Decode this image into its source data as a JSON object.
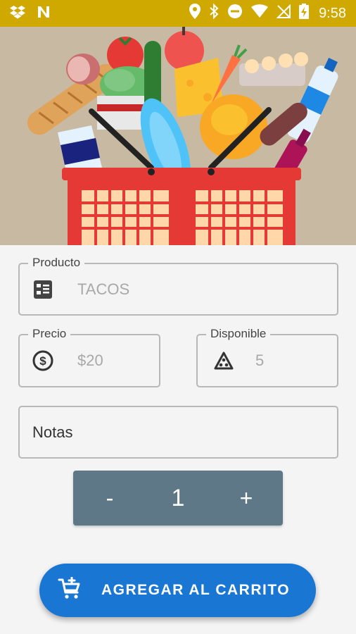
{
  "status_bar": {
    "time": "9:58",
    "icons": [
      "dropbox-icon",
      "n-app-icon",
      "location-icon",
      "bluetooth-icon",
      "do-not-disturb-icon",
      "wifi-icon",
      "no-signal-icon",
      "battery-charging-icon"
    ]
  },
  "form": {
    "producto": {
      "label": "Producto",
      "value": "TACOS",
      "icon": "list-icon"
    },
    "precio": {
      "label": "Precio",
      "value": "$20",
      "icon": "dollar-circle-icon"
    },
    "disponible": {
      "label": "Disponible",
      "value": "5",
      "icon": "stock-triangle-icon"
    },
    "notas": {
      "placeholder": "Notas"
    }
  },
  "stepper": {
    "minus": "-",
    "quantity": "1",
    "plus": "+"
  },
  "add_to_cart": {
    "label": "AGREGAR AL CARRITO",
    "icon": "add-cart-icon"
  },
  "colors": {
    "status_bar": "#cfa800",
    "stepper": "#5f7888",
    "primary_button": "#1976d2",
    "hero_bg": "#c8b9a3"
  }
}
